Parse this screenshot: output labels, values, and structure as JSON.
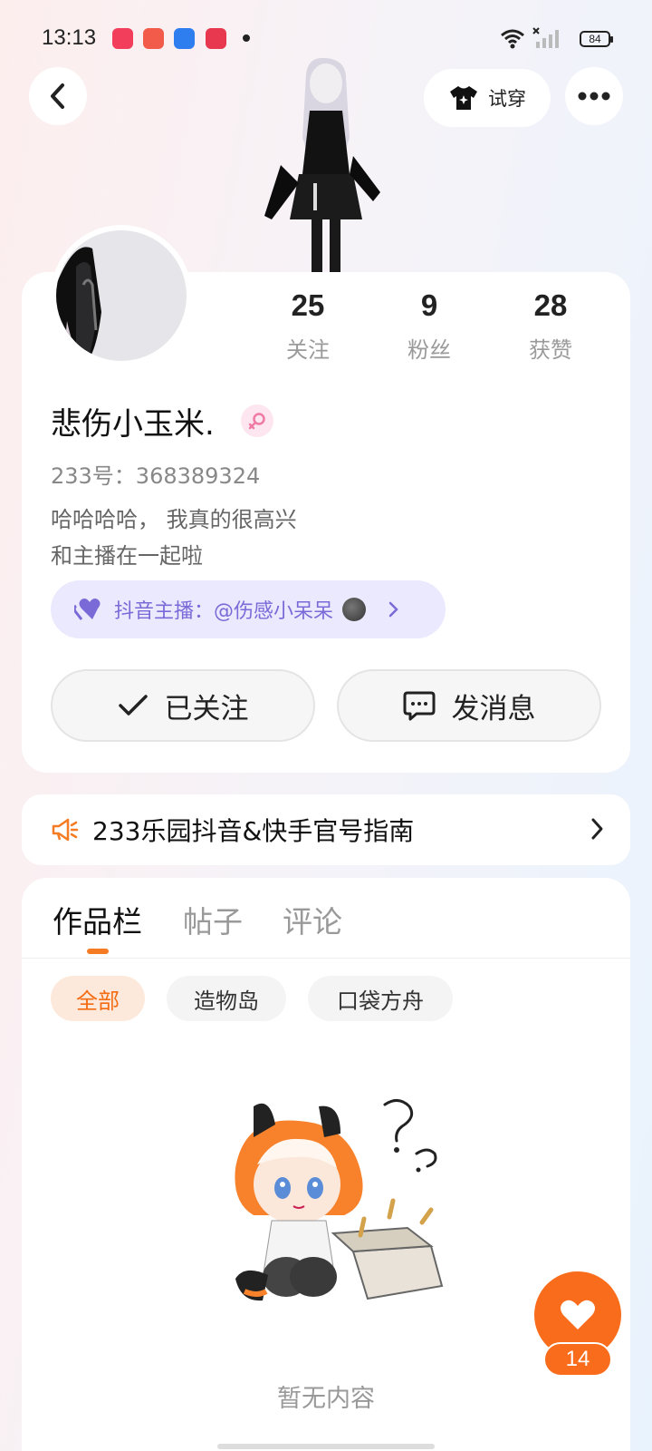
{
  "status_bar": {
    "time": "13:13",
    "battery": "84"
  },
  "header": {
    "try_on_label": "试穿"
  },
  "profile": {
    "stats": [
      {
        "value": "25",
        "label": "关注"
      },
      {
        "value": "9",
        "label": "粉丝"
      },
      {
        "value": "28",
        "label": "获赞"
      }
    ],
    "nickname": "悲伤小玉米.",
    "uid": "233号：368389324",
    "bio_line1": "哈哈哈哈， 我真的很高兴",
    "bio_line2": "和主播在一起啦",
    "anchor_tag": "抖音主播：@伤感小呆呆",
    "follow_button": "已关注",
    "message_button": "发消息"
  },
  "notice": {
    "text": "233乐园抖音&快手官号指南"
  },
  "tabs": [
    {
      "label": "作品栏"
    },
    {
      "label": "帖子"
    },
    {
      "label": "评论"
    }
  ],
  "filters": [
    {
      "label": "全部"
    },
    {
      "label": "造物岛"
    },
    {
      "label": "口袋方舟"
    }
  ],
  "empty_text": "暂无内容",
  "like_count": "14",
  "colors": {
    "accent": "#f86c1b",
    "anchor_text": "#7a6ad8",
    "anchor_bg": "#ebe9fd"
  }
}
